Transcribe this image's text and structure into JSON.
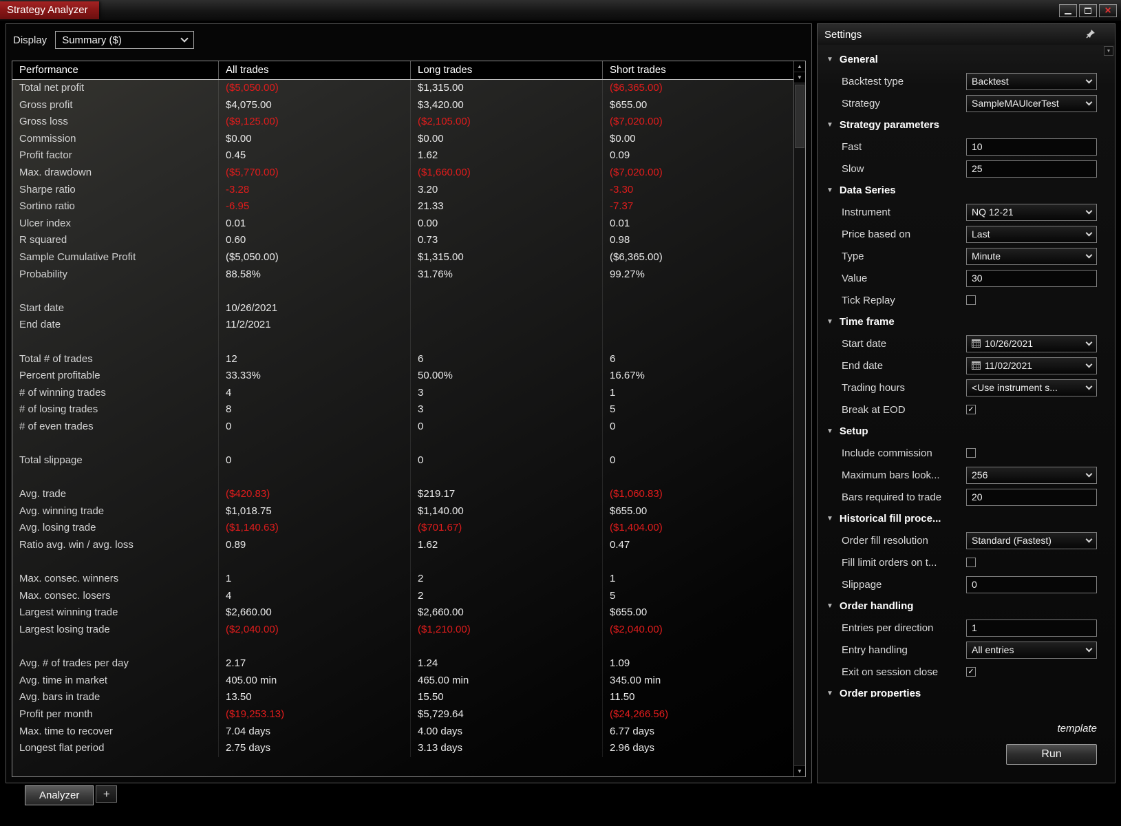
{
  "window": {
    "title": "Strategy Analyzer"
  },
  "toolbar": {
    "display_label": "Display",
    "display_value": "Summary ($)"
  },
  "colors": {
    "negative": "#e11c1c",
    "title_red": "#8a1717"
  },
  "table": {
    "columns": [
      "Performance",
      "All trades",
      "Long trades",
      "Short trades"
    ],
    "rows": [
      {
        "label": "Total net profit",
        "cells": [
          [
            "($5,050.00)",
            1
          ],
          [
            "$1,315.00",
            0
          ],
          [
            "($6,365.00)",
            1
          ]
        ]
      },
      {
        "label": "Gross profit",
        "cells": [
          [
            "$4,075.00",
            0
          ],
          [
            "$3,420.00",
            0
          ],
          [
            "$655.00",
            0
          ]
        ]
      },
      {
        "label": "Gross loss",
        "cells": [
          [
            "($9,125.00)",
            1
          ],
          [
            "($2,105.00)",
            1
          ],
          [
            "($7,020.00)",
            1
          ]
        ]
      },
      {
        "label": "Commission",
        "cells": [
          [
            "$0.00",
            0
          ],
          [
            "$0.00",
            0
          ],
          [
            "$0.00",
            0
          ]
        ]
      },
      {
        "label": "Profit factor",
        "cells": [
          [
            "0.45",
            0
          ],
          [
            "1.62",
            0
          ],
          [
            "0.09",
            0
          ]
        ]
      },
      {
        "label": "Max. drawdown",
        "cells": [
          [
            "($5,770.00)",
            1
          ],
          [
            "($1,660.00)",
            1
          ],
          [
            "($7,020.00)",
            1
          ]
        ]
      },
      {
        "label": "Sharpe ratio",
        "cells": [
          [
            "-3.28",
            1
          ],
          [
            "3.20",
            0
          ],
          [
            "-3.30",
            1
          ]
        ]
      },
      {
        "label": "Sortino ratio",
        "cells": [
          [
            "-6.95",
            1
          ],
          [
            "21.33",
            0
          ],
          [
            "-7.37",
            1
          ]
        ]
      },
      {
        "label": "Ulcer index",
        "cells": [
          [
            "0.01",
            0
          ],
          [
            "0.00",
            0
          ],
          [
            "0.01",
            0
          ]
        ]
      },
      {
        "label": "R squared",
        "cells": [
          [
            "0.60",
            0
          ],
          [
            "0.73",
            0
          ],
          [
            "0.98",
            0
          ]
        ]
      },
      {
        "label": "Sample Cumulative Profit",
        "cells": [
          [
            "($5,050.00)",
            0
          ],
          [
            "$1,315.00",
            0
          ],
          [
            "($6,365.00)",
            0
          ]
        ]
      },
      {
        "label": "Probability",
        "cells": [
          [
            "88.58%",
            0
          ],
          [
            "31.76%",
            0
          ],
          [
            "99.27%",
            0
          ]
        ]
      },
      {
        "label": "",
        "cells": [
          [
            "",
            0
          ],
          [
            "",
            0
          ],
          [
            "",
            0
          ]
        ]
      },
      {
        "label": "Start date",
        "cells": [
          [
            "10/26/2021",
            0
          ],
          [
            "",
            0
          ],
          [
            "",
            0
          ]
        ]
      },
      {
        "label": "End date",
        "cells": [
          [
            "11/2/2021",
            0
          ],
          [
            "",
            0
          ],
          [
            "",
            0
          ]
        ]
      },
      {
        "label": "",
        "cells": [
          [
            "",
            0
          ],
          [
            "",
            0
          ],
          [
            "",
            0
          ]
        ]
      },
      {
        "label": "Total # of trades",
        "cells": [
          [
            "12",
            0
          ],
          [
            "6",
            0
          ],
          [
            "6",
            0
          ]
        ]
      },
      {
        "label": "Percent profitable",
        "cells": [
          [
            "33.33%",
            0
          ],
          [
            "50.00%",
            0
          ],
          [
            "16.67%",
            0
          ]
        ]
      },
      {
        "label": "# of winning trades",
        "cells": [
          [
            "4",
            0
          ],
          [
            "3",
            0
          ],
          [
            "1",
            0
          ]
        ]
      },
      {
        "label": "# of losing trades",
        "cells": [
          [
            "8",
            0
          ],
          [
            "3",
            0
          ],
          [
            "5",
            0
          ]
        ]
      },
      {
        "label": "# of even trades",
        "cells": [
          [
            "0",
            0
          ],
          [
            "0",
            0
          ],
          [
            "0",
            0
          ]
        ]
      },
      {
        "label": "",
        "cells": [
          [
            "",
            0
          ],
          [
            "",
            0
          ],
          [
            "",
            0
          ]
        ]
      },
      {
        "label": "Total slippage",
        "cells": [
          [
            "0",
            0
          ],
          [
            "0",
            0
          ],
          [
            "0",
            0
          ]
        ]
      },
      {
        "label": "",
        "cells": [
          [
            "",
            0
          ],
          [
            "",
            0
          ],
          [
            "",
            0
          ]
        ]
      },
      {
        "label": "Avg. trade",
        "cells": [
          [
            "($420.83)",
            1
          ],
          [
            "$219.17",
            0
          ],
          [
            "($1,060.83)",
            1
          ]
        ]
      },
      {
        "label": "Avg. winning trade",
        "cells": [
          [
            "$1,018.75",
            0
          ],
          [
            "$1,140.00",
            0
          ],
          [
            "$655.00",
            0
          ]
        ]
      },
      {
        "label": "Avg. losing trade",
        "cells": [
          [
            "($1,140.63)",
            1
          ],
          [
            "($701.67)",
            1
          ],
          [
            "($1,404.00)",
            1
          ]
        ]
      },
      {
        "label": "Ratio avg. win / avg. loss",
        "cells": [
          [
            "0.89",
            0
          ],
          [
            "1.62",
            0
          ],
          [
            "0.47",
            0
          ]
        ]
      },
      {
        "label": "",
        "cells": [
          [
            "",
            0
          ],
          [
            "",
            0
          ],
          [
            "",
            0
          ]
        ]
      },
      {
        "label": "Max. consec. winners",
        "cells": [
          [
            "1",
            0
          ],
          [
            "2",
            0
          ],
          [
            "1",
            0
          ]
        ]
      },
      {
        "label": "Max. consec. losers",
        "cells": [
          [
            "4",
            0
          ],
          [
            "2",
            0
          ],
          [
            "5",
            0
          ]
        ]
      },
      {
        "label": "Largest winning trade",
        "cells": [
          [
            "$2,660.00",
            0
          ],
          [
            "$2,660.00",
            0
          ],
          [
            "$655.00",
            0
          ]
        ]
      },
      {
        "label": "Largest losing trade",
        "cells": [
          [
            "($2,040.00)",
            1
          ],
          [
            "($1,210.00)",
            1
          ],
          [
            "($2,040.00)",
            1
          ]
        ]
      },
      {
        "label": "",
        "cells": [
          [
            "",
            0
          ],
          [
            "",
            0
          ],
          [
            "",
            0
          ]
        ]
      },
      {
        "label": "Avg. # of trades per day",
        "cells": [
          [
            "2.17",
            0
          ],
          [
            "1.24",
            0
          ],
          [
            "1.09",
            0
          ]
        ]
      },
      {
        "label": "Avg. time in market",
        "cells": [
          [
            "405.00 min",
            0
          ],
          [
            "465.00 min",
            0
          ],
          [
            "345.00 min",
            0
          ]
        ]
      },
      {
        "label": "Avg. bars in trade",
        "cells": [
          [
            "13.50",
            0
          ],
          [
            "15.50",
            0
          ],
          [
            "11.50",
            0
          ]
        ]
      },
      {
        "label": "Profit per month",
        "cells": [
          [
            "($19,253.13)",
            1
          ],
          [
            "$5,729.64",
            0
          ],
          [
            "($24,266.56)",
            1
          ]
        ]
      },
      {
        "label": "Max. time to recover",
        "cells": [
          [
            "7.04 days",
            0
          ],
          [
            "4.00 days",
            0
          ],
          [
            "6.77 days",
            0
          ]
        ]
      },
      {
        "label": "Longest flat period",
        "cells": [
          [
            "2.75 days",
            0
          ],
          [
            "3.13 days",
            0
          ],
          [
            "2.96 days",
            0
          ]
        ]
      }
    ]
  },
  "settings": {
    "title": "Settings",
    "sections": [
      {
        "label": "General",
        "rows": [
          {
            "label": "Backtest type",
            "type": "select",
            "value": "Backtest"
          },
          {
            "label": "Strategy",
            "type": "select",
            "value": "SampleMAUlcerTest"
          }
        ]
      },
      {
        "label": "Strategy parameters",
        "rows": [
          {
            "label": "Fast",
            "type": "input",
            "value": "10"
          },
          {
            "label": "Slow",
            "type": "input",
            "value": "25"
          }
        ]
      },
      {
        "label": "Data Series",
        "rows": [
          {
            "label": "Instrument",
            "type": "select",
            "value": "NQ 12-21"
          },
          {
            "label": "Price based on",
            "type": "select",
            "value": "Last"
          },
          {
            "label": "Type",
            "type": "select",
            "value": "Minute"
          },
          {
            "label": "Value",
            "type": "input",
            "value": "30"
          },
          {
            "label": "Tick Replay",
            "type": "check",
            "checked": false
          }
        ]
      },
      {
        "label": "Time frame",
        "rows": [
          {
            "label": "Start date",
            "type": "date",
            "value": "10/26/2021"
          },
          {
            "label": "End date",
            "type": "date",
            "value": "11/02/2021"
          },
          {
            "label": "Trading hours",
            "type": "select",
            "value": "<Use instrument s..."
          },
          {
            "label": "Break at EOD",
            "type": "check",
            "checked": true
          }
        ]
      },
      {
        "label": "Setup",
        "rows": [
          {
            "label": "Include commission",
            "type": "check",
            "checked": false
          },
          {
            "label": "Maximum bars look...",
            "type": "select",
            "value": "256"
          },
          {
            "label": "Bars required to trade",
            "type": "input",
            "value": "20"
          }
        ]
      },
      {
        "label": "Historical fill proce...",
        "rows": [
          {
            "label": "Order fill resolution",
            "type": "select",
            "value": "Standard (Fastest)"
          },
          {
            "label": "Fill limit orders on t...",
            "type": "check",
            "checked": false
          },
          {
            "label": "Slippage",
            "type": "input",
            "value": "0"
          }
        ]
      },
      {
        "label": "Order handling",
        "rows": [
          {
            "label": "Entries per direction",
            "type": "input",
            "value": "1"
          },
          {
            "label": "Entry handling",
            "type": "select",
            "value": "All entries"
          },
          {
            "label": "Exit on session close",
            "type": "check",
            "checked": true
          }
        ]
      },
      {
        "label": "Order properties",
        "rows": []
      }
    ],
    "template_label": "template",
    "run_label": "Run"
  },
  "tabs": {
    "active": "Analyzer",
    "add": "+"
  }
}
